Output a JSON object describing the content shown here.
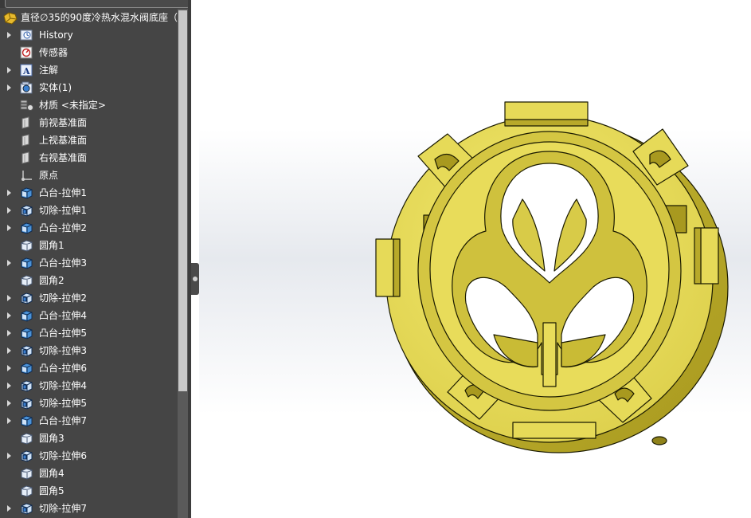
{
  "feature_tree": {
    "root": {
      "label": "直径∅35的90度冷热水混水阀底座（",
      "icon": "part-icon"
    },
    "items": [
      {
        "label": "History",
        "icon": "history-icon",
        "expandable": true
      },
      {
        "label": "传感器",
        "icon": "sensor-icon",
        "expandable": false
      },
      {
        "label": "注解",
        "icon": "annotation-icon",
        "expandable": true
      },
      {
        "label": "实体(1)",
        "icon": "solid-bodies-icon",
        "expandable": true
      },
      {
        "label": "材质 <未指定>",
        "icon": "material-icon",
        "expandable": false
      },
      {
        "label": "前视基准面",
        "icon": "plane-icon",
        "expandable": false
      },
      {
        "label": "上视基准面",
        "icon": "plane-icon",
        "expandable": false
      },
      {
        "label": "右视基准面",
        "icon": "plane-icon",
        "expandable": false
      },
      {
        "label": "原点",
        "icon": "origin-icon",
        "expandable": false
      },
      {
        "label": "凸台-拉伸1",
        "icon": "boss-extrude-icon",
        "expandable": true
      },
      {
        "label": "切除-拉伸1",
        "icon": "cut-extrude-icon",
        "expandable": true
      },
      {
        "label": "凸台-拉伸2",
        "icon": "boss-extrude-icon",
        "expandable": true
      },
      {
        "label": "圆角1",
        "icon": "fillet-icon",
        "expandable": false
      },
      {
        "label": "凸台-拉伸3",
        "icon": "boss-extrude-icon",
        "expandable": true
      },
      {
        "label": "圆角2",
        "icon": "fillet-icon",
        "expandable": false
      },
      {
        "label": "切除-拉伸2",
        "icon": "cut-extrude-icon",
        "expandable": true
      },
      {
        "label": "凸台-拉伸4",
        "icon": "boss-extrude-icon",
        "expandable": true
      },
      {
        "label": "凸台-拉伸5",
        "icon": "boss-extrude-icon",
        "expandable": true
      },
      {
        "label": "切除-拉伸3",
        "icon": "cut-extrude-icon",
        "expandable": true
      },
      {
        "label": "凸台-拉伸6",
        "icon": "boss-extrude-icon",
        "expandable": true
      },
      {
        "label": "切除-拉伸4",
        "icon": "cut-extrude-icon",
        "expandable": true
      },
      {
        "label": "切除-拉伸5",
        "icon": "cut-extrude-icon",
        "expandable": true
      },
      {
        "label": "凸台-拉伸7",
        "icon": "boss-extrude-icon",
        "expandable": true
      },
      {
        "label": "圆角3",
        "icon": "fillet-icon",
        "expandable": false
      },
      {
        "label": "切除-拉伸6",
        "icon": "cut-extrude-icon",
        "expandable": true
      },
      {
        "label": "圆角4",
        "icon": "fillet-icon",
        "expandable": false
      },
      {
        "label": "圆角5",
        "icon": "fillet-icon",
        "expandable": false
      },
      {
        "label": "切除-拉伸7",
        "icon": "cut-extrude-icon",
        "expandable": true
      }
    ]
  },
  "colors": {
    "panel_bg": "#454545",
    "tree_text": "#ffffff",
    "model_yellow": "#e8dc5a",
    "model_shadow": "#b8a92a",
    "model_edge": "#1a1a00",
    "viewport_bg": "#ffffff"
  }
}
